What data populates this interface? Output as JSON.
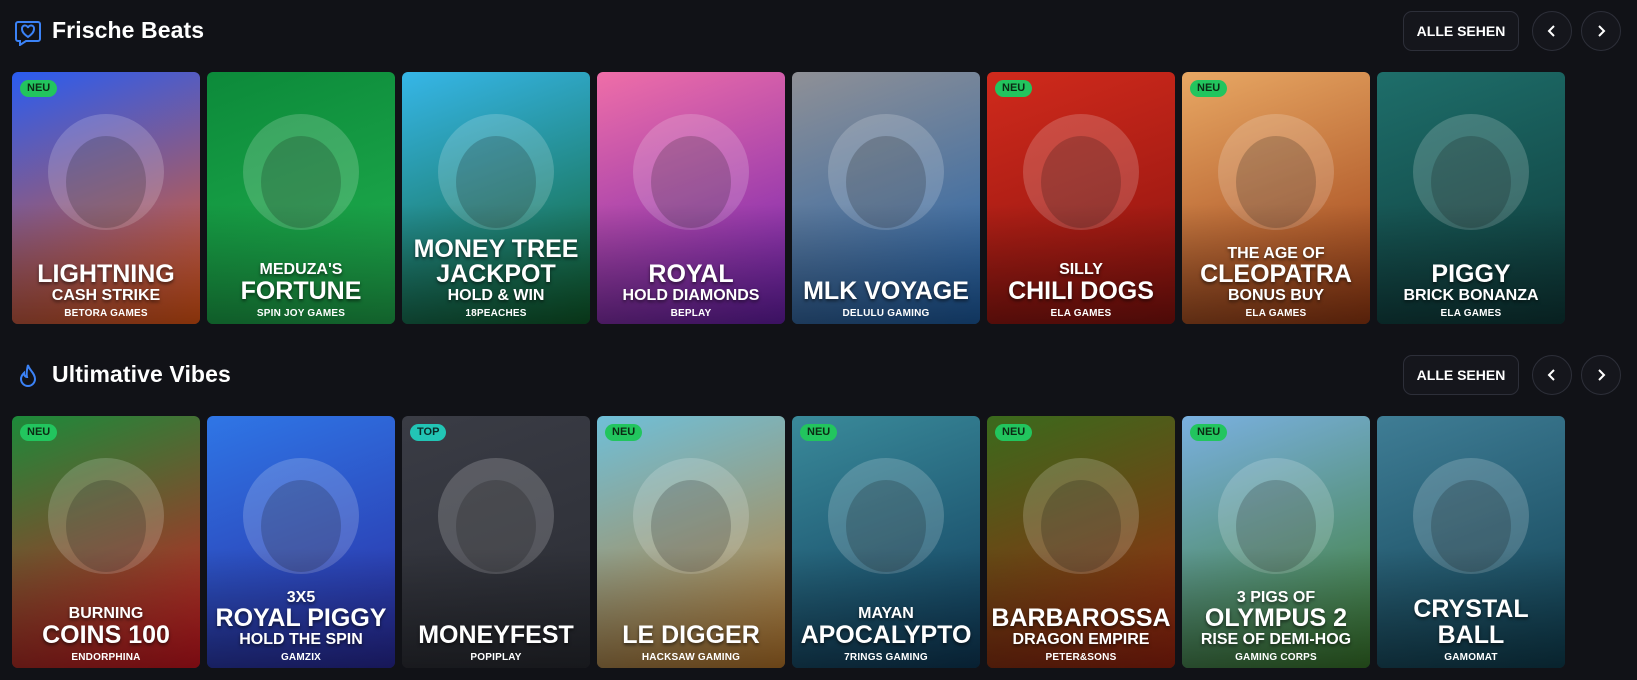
{
  "sections": [
    {
      "title": "Frische Beats",
      "icon": "heart-badge-icon",
      "see_all_label": "ALLE SEHEN",
      "games": [
        {
          "badge": "NEU",
          "l1": "",
          "l2": "LIGHTNING",
          "l3": "CASH STRIKE",
          "provider": "BETORA GAMES",
          "colors": [
            "#2a5cf0",
            "#f25a12"
          ]
        },
        {
          "badge": "",
          "l1": "MEDUZA'S",
          "l2": "FORTUNE",
          "l3": "",
          "provider": "SPIN JOY GAMES",
          "colors": [
            "#0c8a3a",
            "#21b04f"
          ]
        },
        {
          "badge": "",
          "l1": "",
          "l2": "MONEY TREE",
          "l3": "HOLD & WIN",
          "l2b": "JACKPOT",
          "provider": "18PEACHES",
          "colors": [
            "#36b6e8",
            "#0f5f2a"
          ]
        },
        {
          "badge": "",
          "l1": "",
          "l2": "ROYAL",
          "l3": "HOLD DIAMONDS",
          "provider": "BEPLAY",
          "colors": [
            "#ef6ea8",
            "#6a1fb0"
          ]
        },
        {
          "badge": "",
          "l1": "",
          "l2": "MLK VOYAGE",
          "l3": "",
          "provider": "DELULU GAMING",
          "colors": [
            "#8f9096",
            "#1d5fa8"
          ]
        },
        {
          "badge": "NEU",
          "l1": "SILLY",
          "l2": "CHILI DOGS",
          "l3": "",
          "provider": "ELA GAMES",
          "colors": [
            "#d02a1c",
            "#8a120e"
          ]
        },
        {
          "badge": "NEU",
          "l1": "THE AGE OF",
          "l2": "CLEOPATRA",
          "l3": "BONUS BUY",
          "provider": "ELA GAMES",
          "colors": [
            "#e8a864",
            "#9a3a12"
          ]
        },
        {
          "badge": "",
          "l1": "",
          "l2": "PIGGY",
          "l3": "BRICK BONANZA",
          "provider": "ELA GAMES",
          "colors": [
            "#1e6e6a",
            "#0e3a3a"
          ]
        }
      ]
    },
    {
      "title": "Ultimative Vibes",
      "icon": "flame-icon",
      "see_all_label": "ALLE SEHEN",
      "games": [
        {
          "badge": "NEU",
          "l1": "BURNING",
          "l2": "COINS 100",
          "l3": "",
          "provider": "ENDORPHINA",
          "colors": [
            "#1c8a3a",
            "#d91420"
          ]
        },
        {
          "badge": "",
          "l1": "3X5",
          "l2": "ROYAL PIGGY",
          "l3": "HOLD THE SPIN",
          "provider": "GAMZIX",
          "colors": [
            "#2f76e6",
            "#2a2aa0"
          ]
        },
        {
          "badge": "TOP",
          "l1": "",
          "l2": "MONEYFEST",
          "l3": "",
          "provider": "POPIPLAY",
          "colors": [
            "#3a3c45",
            "#2a2c33"
          ]
        },
        {
          "badge": "NEU",
          "l1": "",
          "l2": "LE DIGGER",
          "l3": "",
          "provider": "HACKSAW GAMING",
          "colors": [
            "#6fbfd8",
            "#c07a2a"
          ]
        },
        {
          "badge": "NEU",
          "l1": "MAYAN",
          "l2": "APOCALYPTO",
          "l3": "",
          "provider": "7RINGS GAMING",
          "colors": [
            "#3a8a9a",
            "#0e3a5a"
          ]
        },
        {
          "badge": "NEU",
          "l1": "",
          "l2": "BARBAROSSA",
          "l3": "DRAGON EMPIRE",
          "provider": "PETER&SONS",
          "colors": [
            "#3a6a1c",
            "#a0220e"
          ]
        },
        {
          "badge": "NEU",
          "l1": "3 PIGS OF",
          "l2": "OLYMPUS 2",
          "l3": "RISE OF DEMI-HOG",
          "provider": "GAMING CORPS",
          "colors": [
            "#7ab0e0",
            "#3a7a2a"
          ]
        },
        {
          "badge": "",
          "l1": "",
          "l2": "CRYSTAL",
          "l3": "",
          "l2b": "BALL",
          "provider": "GAMOMAT",
          "colors": [
            "#3f7d95",
            "#0f3f52"
          ]
        }
      ]
    }
  ]
}
